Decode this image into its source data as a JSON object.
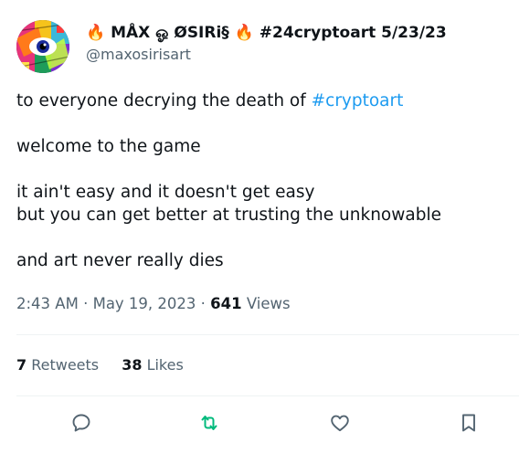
{
  "tweet": {
    "display_name": "🔥 MÅX ஓ ØSIRi§ 🔥 #24cryptoart 5/23/23",
    "handle": "@maxosirisart",
    "body": {
      "line1_prefix": "to everyone decrying the death of ",
      "line1_hashtag": "#cryptoart",
      "line2": "welcome to the game",
      "line3": "it ain't easy and it doesn't get easy",
      "line4": "but you can get better at trusting the unknowable",
      "line5": "and art never really dies"
    },
    "meta": {
      "time": "2:43 AM",
      "separator1": " · ",
      "date": "May 19, 2023",
      "separator2": " · ",
      "views_count": "641",
      "views_label": " Views"
    },
    "stats": {
      "retweets_count": "7",
      "retweets_label": " Retweets",
      "likes_count": "38",
      "likes_label": " Likes"
    },
    "actions": [
      "reply-icon",
      "retweet-icon",
      "like-icon",
      "bookmark-icon"
    ],
    "colors": {
      "hashtag": "#1d9bf0",
      "retweet_action": "#00ba7c",
      "secondary_text": "#536471",
      "primary_text": "#0f1419"
    }
  }
}
